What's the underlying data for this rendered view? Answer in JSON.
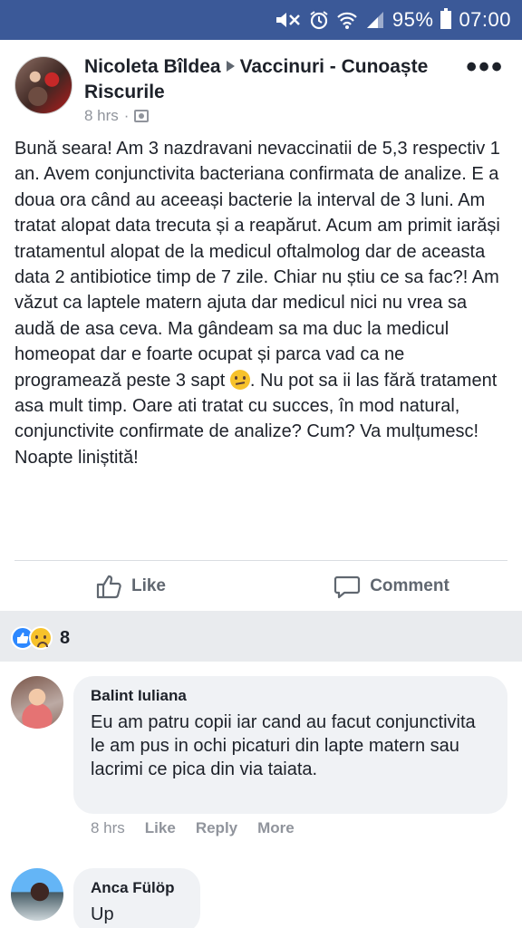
{
  "status_bar": {
    "battery": "95%",
    "time": "07:00",
    "icons": [
      "mute-icon",
      "alarm-icon",
      "wifi-icon",
      "signal-icon",
      "battery-icon"
    ]
  },
  "post": {
    "author": "Nicoleta Bîldea",
    "group": "Vaccinuri - Cunoaște Riscurile",
    "time": "8 hrs",
    "separator": "·",
    "body_part1": "Bună seara! Am 3 nazdravani nevaccinatii de 5,3 respectiv 1 an. Avem conjunctivita bacteriana confirmata de analize. E a doua ora când au aceeași bacterie la interval de 3 luni. Am tratat alopat data trecuta și a reapărut. Acum am primit iarăși tratamentul alopat de la medicul oftalmolog dar de aceasta data 2 antibiotice timp de 7 zile. Chiar nu știu ce sa fac?! Am văzut ca laptele matern ajuta dar medicul nici nu vrea sa audă de asa ceva. Ma gândeam sa ma duc la medicul homeopat dar e foarte ocupat și parca vad ca ne programează peste 3 sapt ",
    "body_part2": ". Nu pot sa ii las fără tratament asa mult timp. Oare ati tratat cu succes, în mod natural, conjunctivite confirmate de analize? Cum? Va mulțumesc! Noapte liniștită!",
    "actions": {
      "like": "Like",
      "comment": "Comment"
    },
    "reaction_count": "8"
  },
  "comments": [
    {
      "author": "Balint Iuliana",
      "text": "Eu am patru copii iar cand au facut conjunctivita le am pus in ochi picaturi din lapte matern sau lacrimi ce pica din via taiata.",
      "time": "8 hrs",
      "like": "Like",
      "reply": "Reply",
      "more": "More"
    },
    {
      "author": "Anca Fülöp",
      "text": "Up"
    }
  ],
  "colors": {
    "brand": "#3b5998",
    "like_blue": "#2d88ff",
    "text": "#1d2129",
    "meta": "#90949c"
  }
}
